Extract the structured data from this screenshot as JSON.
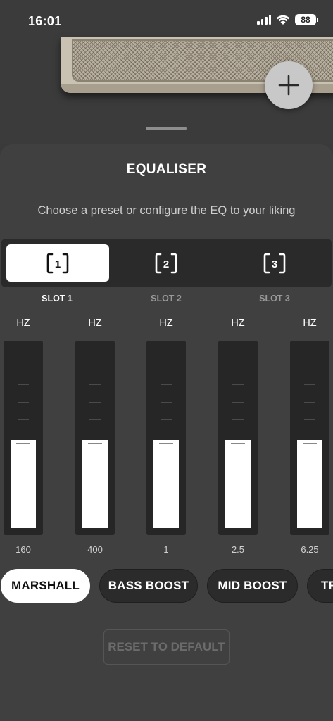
{
  "status_bar": {
    "time": "16:01",
    "battery": "88",
    "icons": [
      "signal-icon",
      "wifi-icon",
      "battery-icon"
    ]
  },
  "header": {
    "add_icon": "plus-icon"
  },
  "equaliser": {
    "title": "EQUALISER",
    "subtitle": "Choose a preset or configure the EQ to your liking",
    "slots": [
      {
        "icon_text": "1",
        "label": "SLOT 1",
        "active": true
      },
      {
        "icon_text": "2",
        "label": "SLOT 2",
        "active": false
      },
      {
        "icon_text": "3",
        "label": "SLOT 3",
        "active": false
      }
    ],
    "bands": [
      {
        "unit": "HZ",
        "freq": "160",
        "level": 0.49
      },
      {
        "unit": "HZ",
        "freq": "400",
        "level": 0.49
      },
      {
        "unit": "HZ",
        "freq": "1",
        "level": 0.49
      },
      {
        "unit": "HZ",
        "freq": "2.5",
        "level": 0.49
      },
      {
        "unit": "HZ",
        "freq": "6.25",
        "level": 0.49
      }
    ],
    "presets": [
      {
        "label": "MARSHALL",
        "active": true
      },
      {
        "label": "BASS BOOST",
        "active": false
      },
      {
        "label": "MID BOOST",
        "active": false
      },
      {
        "label": "TR",
        "active": false
      }
    ],
    "reset_label": "RESET TO DEFAULT"
  },
  "colors": {
    "background": "#3a3a3a",
    "sheet": "#404040",
    "active": "#ffffff",
    "inactive_text": "#9a9a9a"
  }
}
